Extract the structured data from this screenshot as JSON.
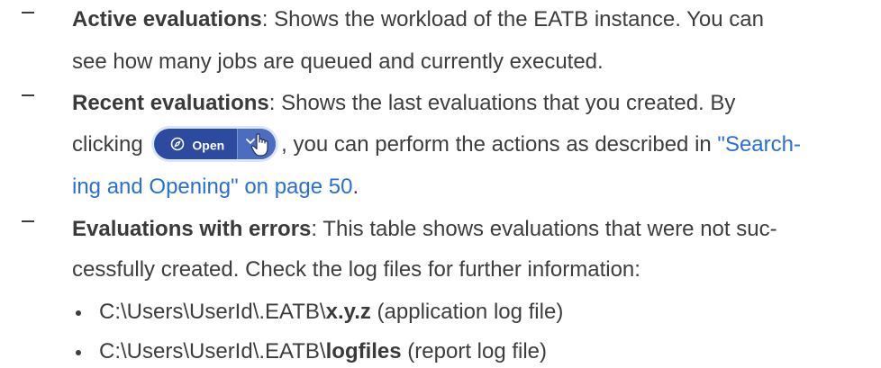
{
  "items": [
    {
      "term": "Active evaluations",
      "line1": ": Shows the workload of the EATB instance. You can",
      "line2": "see how many jobs are queued and currently executed."
    },
    {
      "term": "Recent evaluations",
      "line1": ": Shows the last evaluations that you created. By",
      "line2_before": "clicking",
      "line2_after": ", you can perform the actions as described in",
      "link_part1": "\"Search-",
      "link_part2": "ing and Opening\" on page 50",
      "line3_after": "."
    },
    {
      "term": "Evaluations with errors",
      "line1": ": This table shows evaluations that were not suc-",
      "line2": "cessfully created. Check the log files for further information:",
      "bullets": [
        {
          "path_prefix": "C:\\Users\\UserId\\.EATB\\",
          "path_bold": "x.y.z",
          "desc": " (application log file)"
        },
        {
          "path_prefix": "C:\\Users\\UserId\\.EATB\\",
          "path_bold": "logfiles",
          "desc": " (report log file)"
        }
      ]
    }
  ],
  "open_button": {
    "label": "Open",
    "icon": "compass-icon",
    "dropdown_icon": "chevron-down-icon",
    "cursor_icon": "hand-pointer-icon",
    "bg_color": "#2b4aa0",
    "drop_color": "#4c6cbf"
  },
  "colors": {
    "text": "#3d3d3d",
    "link": "#2a6fd6"
  }
}
